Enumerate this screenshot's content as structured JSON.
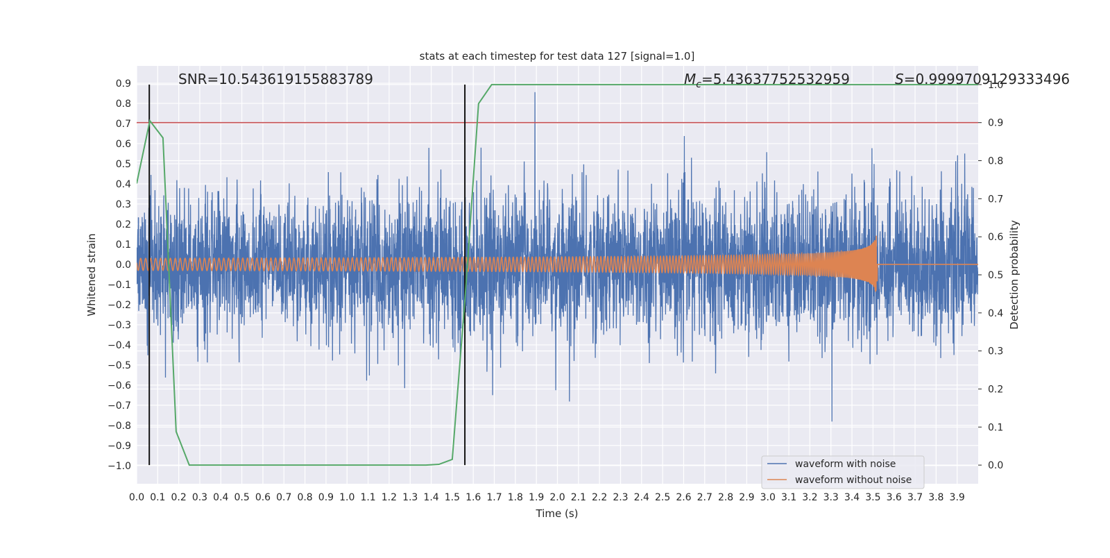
{
  "chart_data": {
    "type": "line",
    "title": "stats at each timestep for test data 127 [signal=1.0]",
    "xlabel": "Time (s)",
    "ylabel": "Whitened strain",
    "y2label": "Detection probability",
    "xlim": [
      0.0,
      4.0
    ],
    "ylim": [
      -1.09,
      0.986
    ],
    "y2lim": [
      -0.049,
      1.049
    ],
    "grid": true,
    "x_ticks": [
      "0.0",
      "0.1",
      "0.2",
      "0.3",
      "0.4",
      "0.5",
      "0.6",
      "0.7",
      "0.8",
      "0.9",
      "1.0",
      "1.1",
      "1.2",
      "1.3",
      "1.4",
      "1.5",
      "1.6",
      "1.7",
      "1.8",
      "1.9",
      "2.0",
      "2.1",
      "2.2",
      "2.3",
      "2.4",
      "2.5",
      "2.6",
      "2.7",
      "2.8",
      "2.9",
      "3.0",
      "3.1",
      "3.2",
      "3.3",
      "3.4",
      "3.5",
      "3.6",
      "3.7",
      "3.8",
      "3.9"
    ],
    "y_ticks": [
      "−1.0",
      "−0.9",
      "−0.8",
      "−0.7",
      "−0.6",
      "−0.5",
      "−0.4",
      "−0.3",
      "−0.2",
      "−0.1",
      "0.0",
      "0.1",
      "0.2",
      "0.3",
      "0.4",
      "0.5",
      "0.6",
      "0.7",
      "0.8",
      "0.9"
    ],
    "y2_ticks": [
      "0.0",
      "0.1",
      "0.2",
      "0.3",
      "0.4",
      "0.5",
      "0.6",
      "0.7",
      "0.8",
      "0.9",
      "1.0"
    ],
    "annotations": {
      "snr": "SNR=10.543619155883789",
      "mc_symbol": "M",
      "mc_sub": "c",
      "mc_value": "=5.43637752532959",
      "s_symbol": "S",
      "s_value": "=0.9999709129333496"
    },
    "legend": {
      "placement": "lower-right",
      "entries": [
        "waveform with noise",
        "waveform without noise"
      ]
    },
    "colors": {
      "noise": "#4c72b0",
      "signal": "#dd8452",
      "probability": "#55a868",
      "threshold": "#c44e52",
      "markers": "#111111",
      "background": "#eaeaf2"
    },
    "series": [
      {
        "name": "waveform with noise",
        "axis": "left",
        "description_values": "noisy strain, |amplitude| mostly below 0.5 with spikes to about 0.9 and -1.0"
      },
      {
        "name": "waveform without noise",
        "axis": "left",
        "amplitude_start": 0.03,
        "amplitude_peak": 0.3,
        "merger_time": 3.52
      },
      {
        "axis": "right",
        "x": [
          0.0,
          0.0625,
          0.125,
          0.1875,
          0.25,
          0.3125,
          0.375,
          0.4375,
          0.5,
          0.5625,
          0.625,
          0.6875,
          0.75,
          0.8125,
          0.875,
          0.9375,
          1.0,
          1.0625,
          1.125,
          1.1875,
          1.25,
          1.3125,
          1.375,
          1.4375,
          1.5,
          1.5625,
          1.625,
          1.6875,
          4.0
        ],
        "y": [
          0.74,
          0.905,
          0.86,
          0.088,
          0.0,
          0.0,
          0.0,
          0.0,
          0.0,
          0.0,
          0.0,
          0.0,
          0.0,
          0.0,
          0.0,
          0.0,
          0.0,
          0.0,
          0.0,
          0.0,
          0.0,
          0.0,
          0.0,
          0.002,
          0.015,
          0.45,
          0.95,
          1.0,
          1.0
        ]
      }
    ],
    "threshold_y2": 0.9,
    "vertical_lines_x": [
      0.06,
      1.56
    ]
  }
}
